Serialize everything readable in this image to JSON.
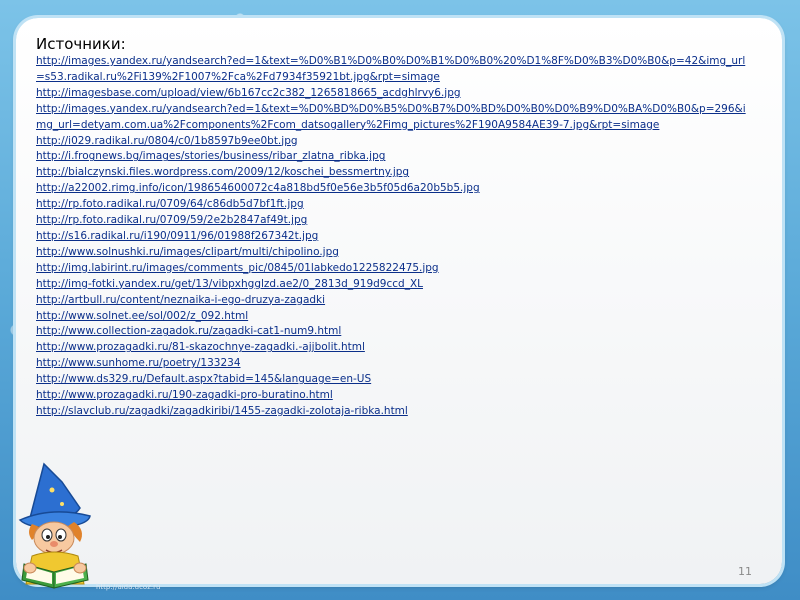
{
  "slide": {
    "heading": "Источники:",
    "page_number": "11",
    "watermark": "http://aida.ucoz.ru"
  },
  "sources": [
    "http://images.yandex.ru/yandsearch?ed=1&text=%D0%B1%D0%B0%D0%B1%D0%B0%20%D1%8F%D0%B3%D0%B0&p=42&img_url=s53.radikal.ru%2Fi139%2F1007%2Fca%2Fd7934f35921bt.jpg&rpt=simage",
    "http://imagesbase.com/upload/view/6b167cc2c382_1265818665_acdghlrvy6.jpg",
    "http://images.yandex.ru/yandsearch?ed=1&text=%D0%BD%D0%B5%D0%B7%D0%BD%D0%B0%D0%B9%D0%BA%D0%B0&p=296&img_url=detyam.com.ua%2Fcomponents%2Fcom_datsogallery%2Fimg_pictures%2F190A9584AE39-7.jpg&rpt=simage",
    "http://i029.radikal.ru/0804/c0/1b8597b9ee0bt.jpg",
    "http://i.frognews.bg/images/stories/business/ribar_zlatna_ribka.jpg",
    "http://bialczynski.files.wordpress.com/2009/12/koschei_bessmertny.jpg",
    "http://a22002.rimg.info/icon/198654600072c4a818bd5f0e56e3b5f05d6a20b5b5.jpg",
    "http://rp.foto.radikal.ru/0709/64/c86db5d7bf1ft.jpg",
    "http://rp.foto.radikal.ru/0709/59/2e2b2847af49t.jpg",
    "http://s16.radikal.ru/i190/0911/96/01988f267342t.jpg",
    "http://www.solnushki.ru/images/clipart/multi/chipolino.jpg",
    "http://img.labirint.ru/images/comments_pic/0845/01labkedo1225822475.jpg",
    "http://img-fotki.yandex.ru/get/13/vibpxhgglzd.ae2/0_2813d_919d9ccd_XL",
    "http://artbull.ru/content/neznaika-i-ego-druzya-zagadki",
    "http://www.solnet.ee/sol/002/z_092.html",
    "http://www.collection-zagadok.ru/zagadki-cat1-num9.html",
    "http://www.prozagadki.ru/81-skazochnye-zagadki.-ajjbolit.html",
    "http://www.sunhome.ru/poetry/133234",
    "http://www.ds329.ru/Default.aspx?tabid=145&language=en-US",
    "http://www.prozagadki.ru/190-zagadki-pro-buratino.html",
    "http://slavclub.ru/zagadki/zagadkiribi/1455-zagadki-zolotaja-ribka.html"
  ],
  "icons": {
    "mascot": "wizard-mascot-reading-book"
  },
  "colors": {
    "frame": "#5aa9d8",
    "link": "#0b2f8a",
    "panel": "#ffffff"
  }
}
